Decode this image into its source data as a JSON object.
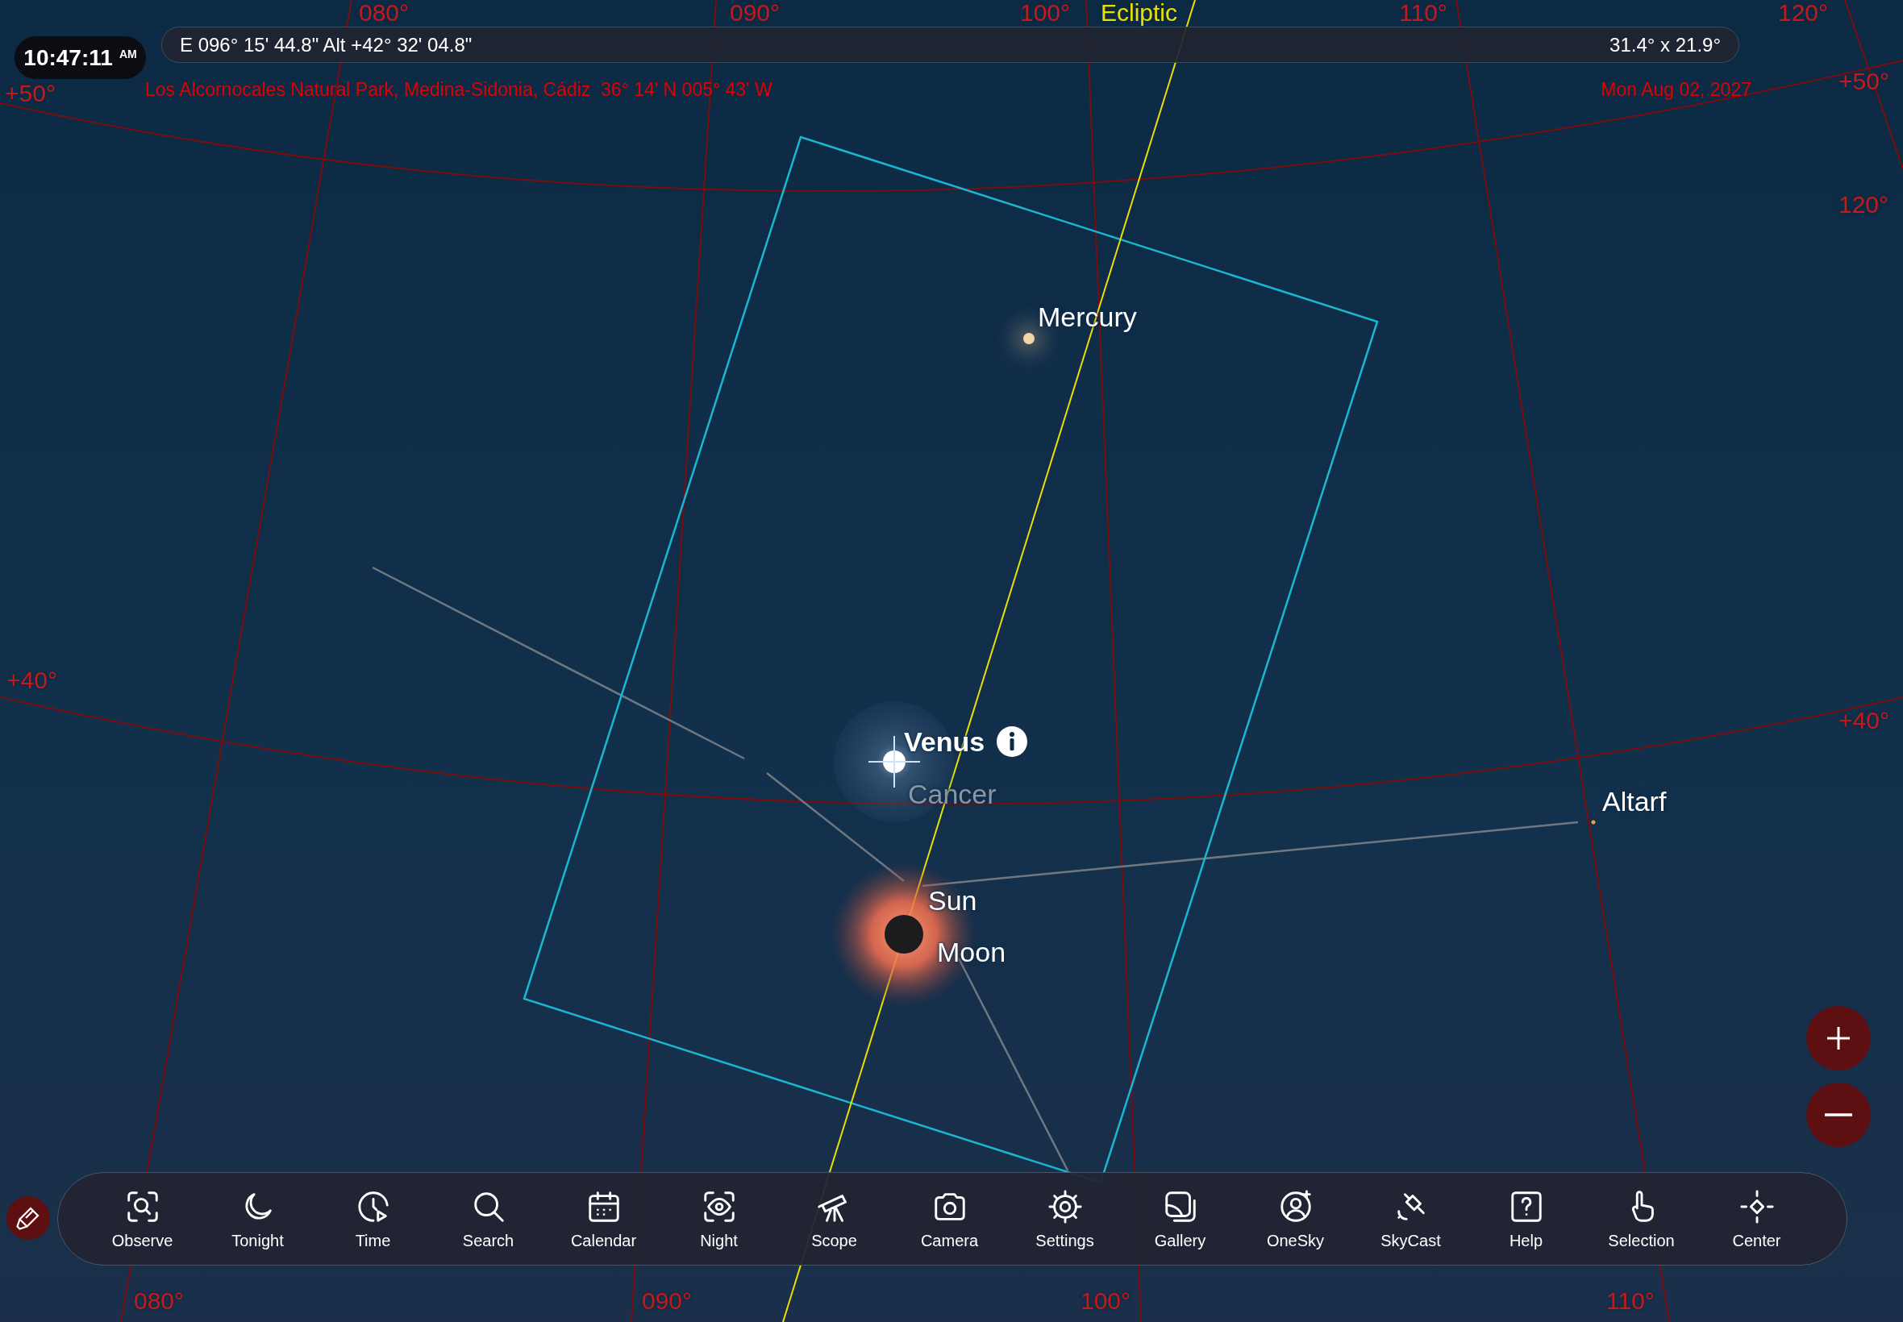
{
  "status": {
    "time": "10:47:11",
    "meridiem": "AM",
    "position": "E 096° 15' 44.8\" Alt +42° 32' 04.8\"",
    "field_of_view": "31.4° x 21.9°",
    "location": "Los Alcornocales Natural Park, Medina-Sidonia, Cádiz  36° 14' N 005° 43' W",
    "date": "Mon Aug 02, 2027"
  },
  "sky_labels": [
    {
      "text": "080°",
      "kind": "grid"
    },
    {
      "text": "090°",
      "kind": "grid"
    },
    {
      "text": "100°",
      "kind": "grid"
    },
    {
      "text": "Ecliptic",
      "kind": "ecliptic"
    },
    {
      "text": "110°",
      "kind": "grid"
    },
    {
      "text": "120°",
      "kind": "grid"
    },
    {
      "text": "+50°",
      "kind": "grid"
    },
    {
      "text": "+50°",
      "kind": "grid"
    },
    {
      "text": "120°",
      "kind": "grid"
    },
    {
      "text": "+40°",
      "kind": "grid"
    },
    {
      "text": "+40°",
      "kind": "grid"
    },
    {
      "text": "080°",
      "kind": "grid"
    },
    {
      "text": "090°",
      "kind": "grid"
    },
    {
      "text": "100°",
      "kind": "grid"
    },
    {
      "text": "110°",
      "kind": "grid"
    }
  ],
  "objects": [
    {
      "name": "Mercury",
      "kind": "planet",
      "selected": false
    },
    {
      "name": "Venus",
      "kind": "planet",
      "selected": true
    },
    {
      "name": "Cancer",
      "kind": "constellation",
      "selected": false
    },
    {
      "name": "Sun",
      "kind": "sun",
      "selected": false
    },
    {
      "name": "Moon",
      "kind": "moon",
      "selected": false
    },
    {
      "name": "Altarf",
      "kind": "star",
      "selected": false
    }
  ],
  "toolbar": [
    {
      "label": "Observe"
    },
    {
      "label": "Tonight"
    },
    {
      "label": "Time"
    },
    {
      "label": "Search"
    },
    {
      "label": "Calendar"
    },
    {
      "label": "Night"
    },
    {
      "label": "Scope"
    },
    {
      "label": "Camera"
    },
    {
      "label": "Settings"
    },
    {
      "label": "Gallery"
    },
    {
      "label": "OneSky"
    },
    {
      "label": "SkyCast"
    },
    {
      "label": "Help"
    },
    {
      "label": "Selection"
    },
    {
      "label": "Center"
    }
  ]
}
